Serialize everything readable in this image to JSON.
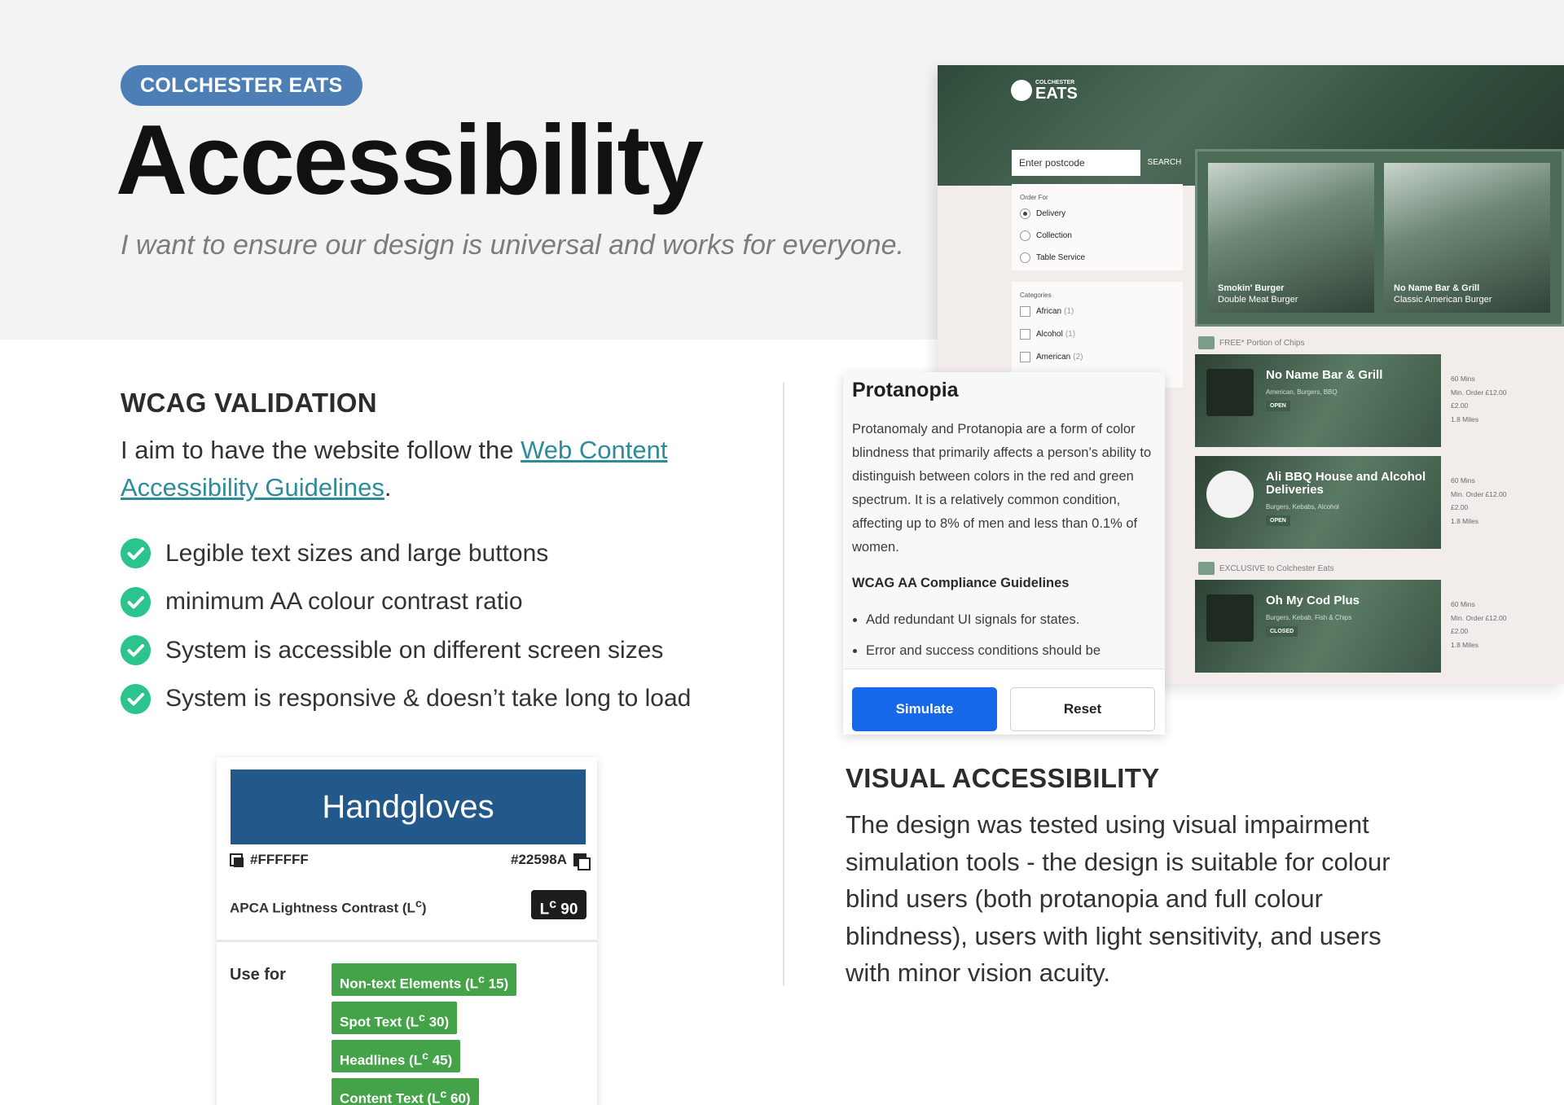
{
  "hero": {
    "tag": "COLCHESTER EATS",
    "title": "Accessibility",
    "subtitle": "I want to ensure our design is universal and works for everyone."
  },
  "wcag": {
    "heading": "WCAG VALIDATION",
    "intro_prefix": "I aim to have the website follow the ",
    "link_text": "Web Content Accessibility Guidelines",
    "intro_suffix": ".",
    "items": [
      "Legible text sizes and large buttons",
      "minimum AA colour contrast ratio",
      "System is accessible on different screen sizes",
      "System is responsive & doesn’t take long to load"
    ]
  },
  "apca": {
    "sample": "Handgloves",
    "fg": "#FFFFFF",
    "bg": "#22598A",
    "label": "APCA Lightness Contrast (L",
    "label_sup": "c",
    "label_end": ")",
    "score_prefix": "L",
    "score_sup": "c",
    "score": "90",
    "use_for": "Use for",
    "uses": [
      {
        "name": "Non-text Elements (L",
        "sup": "c",
        "value": "15)"
      },
      {
        "name": "Spot Text (L",
        "sup": "c",
        "value": "30)"
      },
      {
        "name": "Headlines (L",
        "sup": "c",
        "value": "45)"
      },
      {
        "name": "Content Text (L",
        "sup": "c",
        "value": "60)"
      }
    ],
    "swatch_color": "#22598A",
    "chip_color": "#44A348"
  },
  "app": {
    "brand_small": "COLCHESTER",
    "brand_big": "EATS",
    "search_placeholder": "Enter postcode",
    "search_button": "SEARCH",
    "order_for": "Order For",
    "order_options": [
      "Delivery",
      "Collection",
      "Table Service"
    ],
    "categories_title": "Categories",
    "categories": [
      {
        "name": "African",
        "count": "(1)"
      },
      {
        "name": "Alcohol",
        "count": "(1)"
      },
      {
        "name": "American",
        "count": "(2)"
      }
    ],
    "featured": [
      {
        "name": "Smokin' Burger",
        "dish": "Double Meat Burger"
      },
      {
        "name": "No Name Bar & Grill",
        "dish": "Classic American Burger"
      }
    ],
    "strip_free": "FREE* Portion of Chips",
    "strip_exclusive": "EXCLUSIVE to Colchester Eats",
    "restaurants": [
      {
        "name": "No Name Bar & Grill",
        "tags": "American, Burgers, BBQ",
        "status": "OPEN",
        "meta": [
          "60 Mins",
          "Min. Order £12.00",
          "£2.00",
          "1.8 Miles"
        ]
      },
      {
        "name": "Ali BBQ House and Alcohol Deliveries",
        "tags": "Burgers, Kebabs, Alcohol",
        "status": "OPEN",
        "meta": [
          "60 Mins",
          "Min. Order £12.00",
          "£2.00",
          "1.8 Miles"
        ]
      },
      {
        "name": "Oh My Cod Plus",
        "tags": "Burgers, Kebab, Fish & Chips",
        "status": "CLOSED",
        "meta": [
          "60 Mins",
          "Min. Order £12.00",
          "£2.00",
          "1.8 Miles"
        ]
      }
    ]
  },
  "protanopia": {
    "title": "Protanopia",
    "body": "Protanomaly and Protanopia are a form of color blindness that primarily affects a person’s ability to distinguish between colors in the red and green spectrum. It is a relatively common condition, affecting up to 8% of men and less than 0.1% of women.",
    "sub": "WCAG AA Compliance Guidelines",
    "items": [
      "Add redundant UI signals for states.",
      "Error and success conditions should be"
    ],
    "simulate": "Simulate",
    "reset": "Reset"
  },
  "visual": {
    "heading": "VISUAL ACCESSIBILITY",
    "body": "The design was tested using visual impairment simulation tools - the design is suitable for colour blind users (both protanopia and full colour blindness), users with light sensitivity, and users with minor vision acuity."
  },
  "colors": {
    "tag_bg": "#4D7FB6",
    "check": "#2CC48D",
    "link": "#2E8C9A",
    "simulate_bg": "#1668E8"
  }
}
